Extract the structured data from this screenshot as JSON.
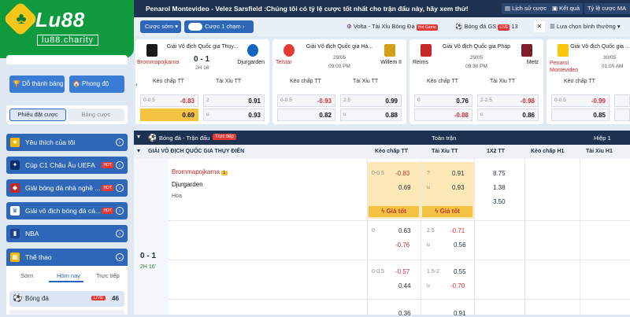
{
  "topbar": {
    "ticker": "Penarol Montevideo - Velez Sarsfield :Chúng tôi có tỷ lệ cược tốt nhất cho trận đấu này, hãy xem thử!",
    "history_btn": "Lịch sử cược",
    "results_btn": "Kết quả",
    "odds_btn": "Tỷ lệ cược MA"
  },
  "logo": {
    "brand": "Lu88",
    "domain": "lu88.charity"
  },
  "toolbar": {
    "early_btn": "Cược sớm",
    "one_bet_toggle": "Cược 1 chạm",
    "live1": "Volta - Tài Xỉu Bóng Đá",
    "live1_badge": "Hot Game",
    "live2": "Bóng đá GS",
    "live2_badge": "LIVE",
    "live2_count": "13",
    "sort": "Lựa chọn bình thường"
  },
  "sidebar": {
    "achievements": "Dỗ thành bảng",
    "room": "Phong độ",
    "tab_betslip": "Phiếu đặt cược",
    "tab_table": "Bảng cược",
    "menu": [
      {
        "label": "Yêu thích của tôi",
        "hot": ""
      },
      {
        "label": "Cúp C1 Châu Âu UEFA",
        "hot": "HOT"
      },
      {
        "label": "Giải bóng đá nhà nghề ...",
        "hot": "HOT"
      },
      {
        "label": "Giải vô địch bóng đá cá...",
        "hot": "HOT"
      },
      {
        "label": "NBA",
        "hot": ""
      },
      {
        "label": "Thể thao",
        "hot": ""
      }
    ],
    "sub_tabs": [
      "Sớm",
      "Hôm nay",
      "Trực tiếp"
    ],
    "sport_row": {
      "label": "Bóng đá",
      "badge": "LIVE",
      "count": "46"
    }
  },
  "cards": [
    {
      "league": "Giải Vô địch Quốc gia Thụy...",
      "home": "Brommapojkarna",
      "away": "Djurgarden",
      "score": "0 - 1",
      "time": "2H 16'",
      "h1": "Kèo chấp TT",
      "h2": "Tài Xỉu TT",
      "o1": [
        "0-0.5",
        "-0.83",
        "2",
        "0.91"
      ],
      "o2": [
        "",
        "0.69",
        "u",
        "0.93"
      ]
    },
    {
      "league": "Giải Vô địch Quốc gia Hà...",
      "home": "Telstar",
      "away": "Willem II",
      "date": "29/05",
      "clock": "09:00 PM",
      "h1": "Kèo chấp TT",
      "h2": "Tài Xỉu TT",
      "o1": [
        "0-0.5",
        "-0.93",
        "2.5",
        "0.99"
      ],
      "o2": [
        "",
        "0.82",
        "u",
        "0.88"
      ]
    },
    {
      "league": "Giải Vô địch Quốc gia Pháp",
      "home": "Reims",
      "away": "Metz",
      "date": "29/05",
      "clock": "09:30 PM",
      "h1": "Kèo chấp TT",
      "h2": "Tài Xỉu TT",
      "o1": [
        "0",
        "0.76",
        "2-2.5",
        "-0.98"
      ],
      "o2": [
        "",
        "-0.88",
        "u",
        "0.86"
      ]
    },
    {
      "league": "Giải Vô địch Quốc gia ...",
      "home": "Penarol Montevideo",
      "away": "",
      "date": "30/05",
      "clock": "01:00 AM",
      "h1": "Kèo chấp TT",
      "h2": "",
      "o1": [
        "0-0.5",
        "-0.99",
        "",
        ""
      ],
      "o2": [
        "",
        "0.85",
        "",
        ""
      ]
    }
  ],
  "table": {
    "sport_header": "Bóng đá - Trận đấu",
    "live_badge": "Trực tiếp",
    "full_match": "Toàn trận",
    "half1": "Hiệp 1",
    "league": "GIẢI VÔ ĐỊCH QUỐC GIA THỤY ĐIỂN",
    "cols": [
      "Kèo chấp TT",
      "Tài Xỉu TT",
      "1X2 TT",
      "Kèo chấp H1",
      "Tài Xỉu H1"
    ],
    "home": "Brommapojkarna",
    "away": "Djurgarden",
    "draw": "Hòa",
    "score": "0 - 1",
    "time": "2H 16'",
    "good_price": "Giá tốt",
    "row1": {
      "hcap_h": "0-0.5",
      "hcap_odd1": "-0.83",
      "hcap_odd2": "0.69",
      "ou_h": "?",
      "ou_odd1": "0.91",
      "ou_u": "u",
      "ou_odd2": "0.93",
      "x1": "8.75",
      "x2": "1.38",
      "x3": "3.50"
    },
    "row2": {
      "hcap_h": "0",
      "hcap_odd1": "0.63",
      "hcap_odd2": "-0.76",
      "ou_h": "2.5",
      "ou_odd1": "-0.71",
      "ou_u": "u",
      "ou_odd2": "0.56"
    },
    "row3": {
      "hcap_h": "0-0.5",
      "hcap_odd1": "-0.57",
      "hcap_odd2": "0.44",
      "ou_h": "1.5-2",
      "ou_odd1": "0.55",
      "ou_u": "u",
      "ou_odd2": "-0.70"
    },
    "row4": {
      "hcap_odd1": "0.36",
      "ou_odd1": "0.91"
    }
  }
}
